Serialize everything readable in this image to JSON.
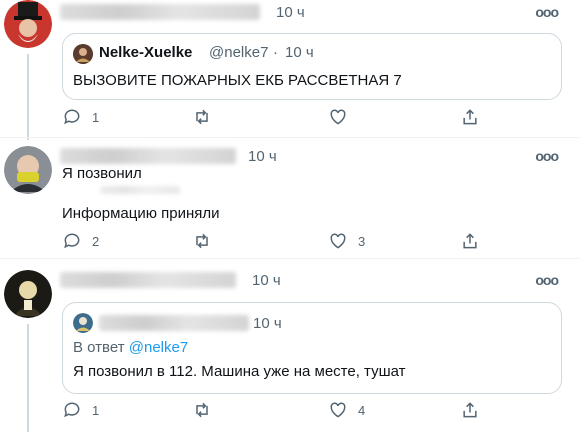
{
  "posts": [
    {
      "time": "10 ч",
      "quote": {
        "name": "Nelke-Xuelke",
        "handle": "@nelke7",
        "sep": "·",
        "time": "10 ч",
        "text": "ВЫЗОВИТЕ ПОЖАРНЫХ ЕКБ РАССВЕТНАЯ 7"
      },
      "counts": {
        "reply": "1",
        "like": ""
      }
    },
    {
      "time": "10 ч",
      "lines": [
        "Я позвонил",
        "Информацию приняли"
      ],
      "counts": {
        "reply": "2",
        "like": "3"
      }
    },
    {
      "time": "10 ч",
      "quote": {
        "time": "10 ч",
        "reply_to_prefix": "В ответ",
        "reply_to_handle": "@nelke7",
        "text": "Я позвонил в 112. Машина уже на месте, тушат"
      },
      "counts": {
        "reply": "1",
        "like": "4"
      }
    }
  ],
  "more_glyph": "ooo",
  "colors": {
    "muted": "#536471",
    "link": "#1d9bf0",
    "border": "#cfd9de"
  }
}
